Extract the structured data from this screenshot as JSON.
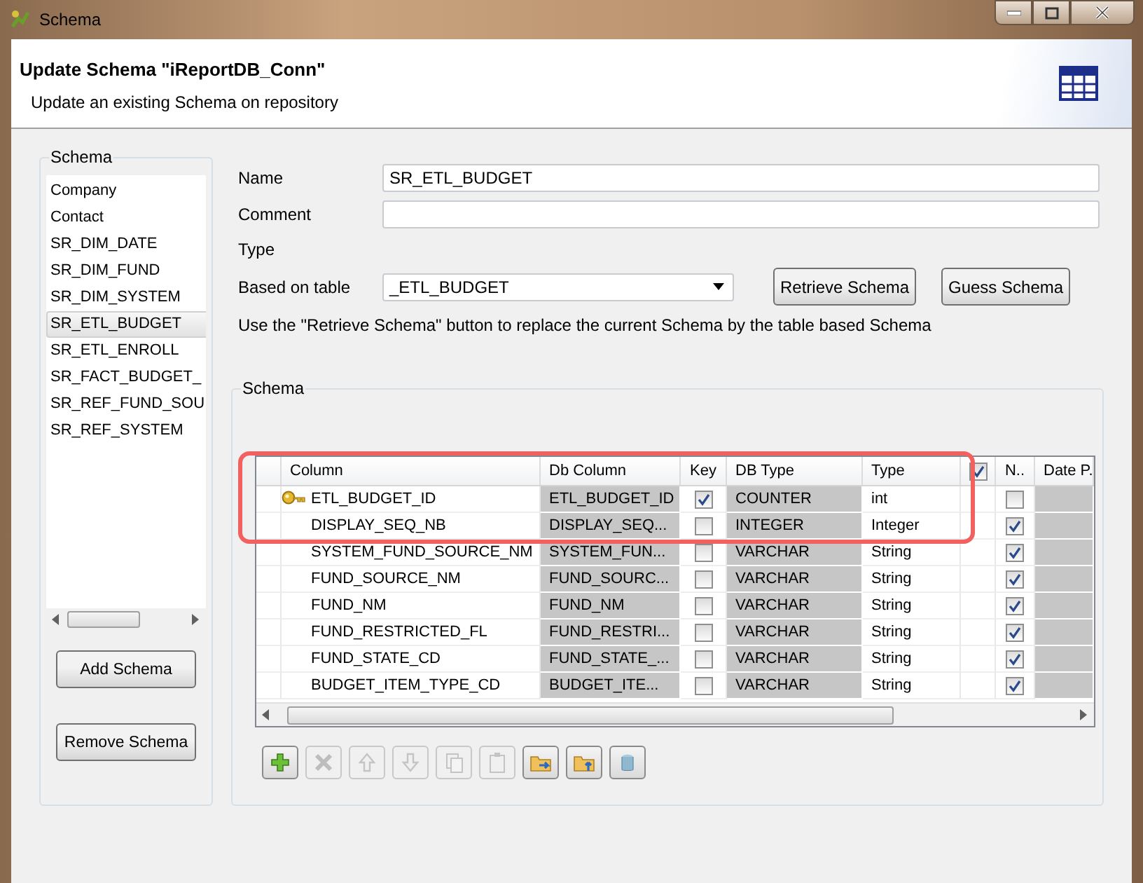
{
  "window": {
    "title": "Schema"
  },
  "header": {
    "title": "Update Schema \"iReportDB_Conn\"",
    "subtitle": "Update an existing Schema on repository"
  },
  "schema_list": {
    "label": "Schema",
    "items": [
      {
        "label": "Company",
        "selected": false
      },
      {
        "label": "Contact",
        "selected": false
      },
      {
        "label": "SR_DIM_DATE",
        "selected": false
      },
      {
        "label": "SR_DIM_FUND",
        "selected": false
      },
      {
        "label": "SR_DIM_SYSTEM",
        "selected": false
      },
      {
        "label": "SR_ETL_BUDGET",
        "selected": true
      },
      {
        "label": "SR_ETL_ENROLL",
        "selected": false
      },
      {
        "label": "SR_FACT_BUDGET_",
        "selected": false
      },
      {
        "label": "SR_REF_FUND_SOU",
        "selected": false
      },
      {
        "label": "SR_REF_SYSTEM",
        "selected": false
      }
    ],
    "buttons": [
      "Add Schema",
      "Remove Schema"
    ]
  },
  "form": {
    "name_label": "Name",
    "name_value": "SR_ETL_BUDGET",
    "comment_label": "Comment",
    "type_label": "Type",
    "based_on_label": "Based on table",
    "based_on_value": "_ETL_BUDGET",
    "buttons": [
      "Retrieve Schema",
      "Guess Schema"
    ],
    "hint": "Use the \"Retrieve Schema\" button to replace the current Schema by the table based Schema"
  },
  "schema_table": {
    "label": "Schema",
    "columns": [
      "Column",
      "Db Column",
      "Key",
      "DB Type",
      "Type",
      "N..",
      "Date P."
    ],
    "all_nullable_checked": true,
    "rows": [
      {
        "column": "ETL_BUDGET_ID",
        "db_column": "ETL_BUDGET_ID",
        "key": true,
        "db_type": "COUNTER",
        "type": "int",
        "nullable": false,
        "highlighted": true
      },
      {
        "column": "DISPLAY_SEQ_NB",
        "db_column": "DISPLAY_SEQ...",
        "key": false,
        "db_type": "INTEGER",
        "type": "Integer",
        "nullable": true,
        "highlighted": true
      },
      {
        "column": "SYSTEM_FUND_SOURCE_NM",
        "db_column": "SYSTEM_FUN...",
        "key": false,
        "db_type": "VARCHAR",
        "type": "String",
        "nullable": true,
        "highlighted": false
      },
      {
        "column": "FUND_SOURCE_NM",
        "db_column": "FUND_SOURC...",
        "key": false,
        "db_type": "VARCHAR",
        "type": "String",
        "nullable": true,
        "highlighted": false
      },
      {
        "column": "FUND_NM",
        "db_column": "FUND_NM",
        "key": false,
        "db_type": "VARCHAR",
        "type": "String",
        "nullable": true,
        "highlighted": false
      },
      {
        "column": "FUND_RESTRICTED_FL",
        "db_column": "FUND_RESTRI...",
        "key": false,
        "db_type": "VARCHAR",
        "type": "String",
        "nullable": true,
        "highlighted": false
      },
      {
        "column": "FUND_STATE_CD",
        "db_column": "FUND_STATE_...",
        "key": false,
        "db_type": "VARCHAR",
        "type": "String",
        "nullable": true,
        "highlighted": false
      },
      {
        "column": "BUDGET_ITEM_TYPE_CD",
        "db_column": "BUDGET_ITE...",
        "key": false,
        "db_type": "VARCHAR",
        "type": "String",
        "nullable": true,
        "highlighted": false
      }
    ]
  },
  "toolbar": [
    {
      "kind": "add",
      "disabled": false
    },
    {
      "kind": "delete",
      "disabled": true
    },
    {
      "kind": "up",
      "disabled": true
    },
    {
      "kind": "down",
      "disabled": true
    },
    {
      "kind": "copy",
      "disabled": true
    },
    {
      "kind": "paste",
      "disabled": true
    },
    {
      "kind": "import",
      "disabled": false
    },
    {
      "kind": "export",
      "disabled": false
    },
    {
      "kind": "database",
      "disabled": false
    }
  ]
}
